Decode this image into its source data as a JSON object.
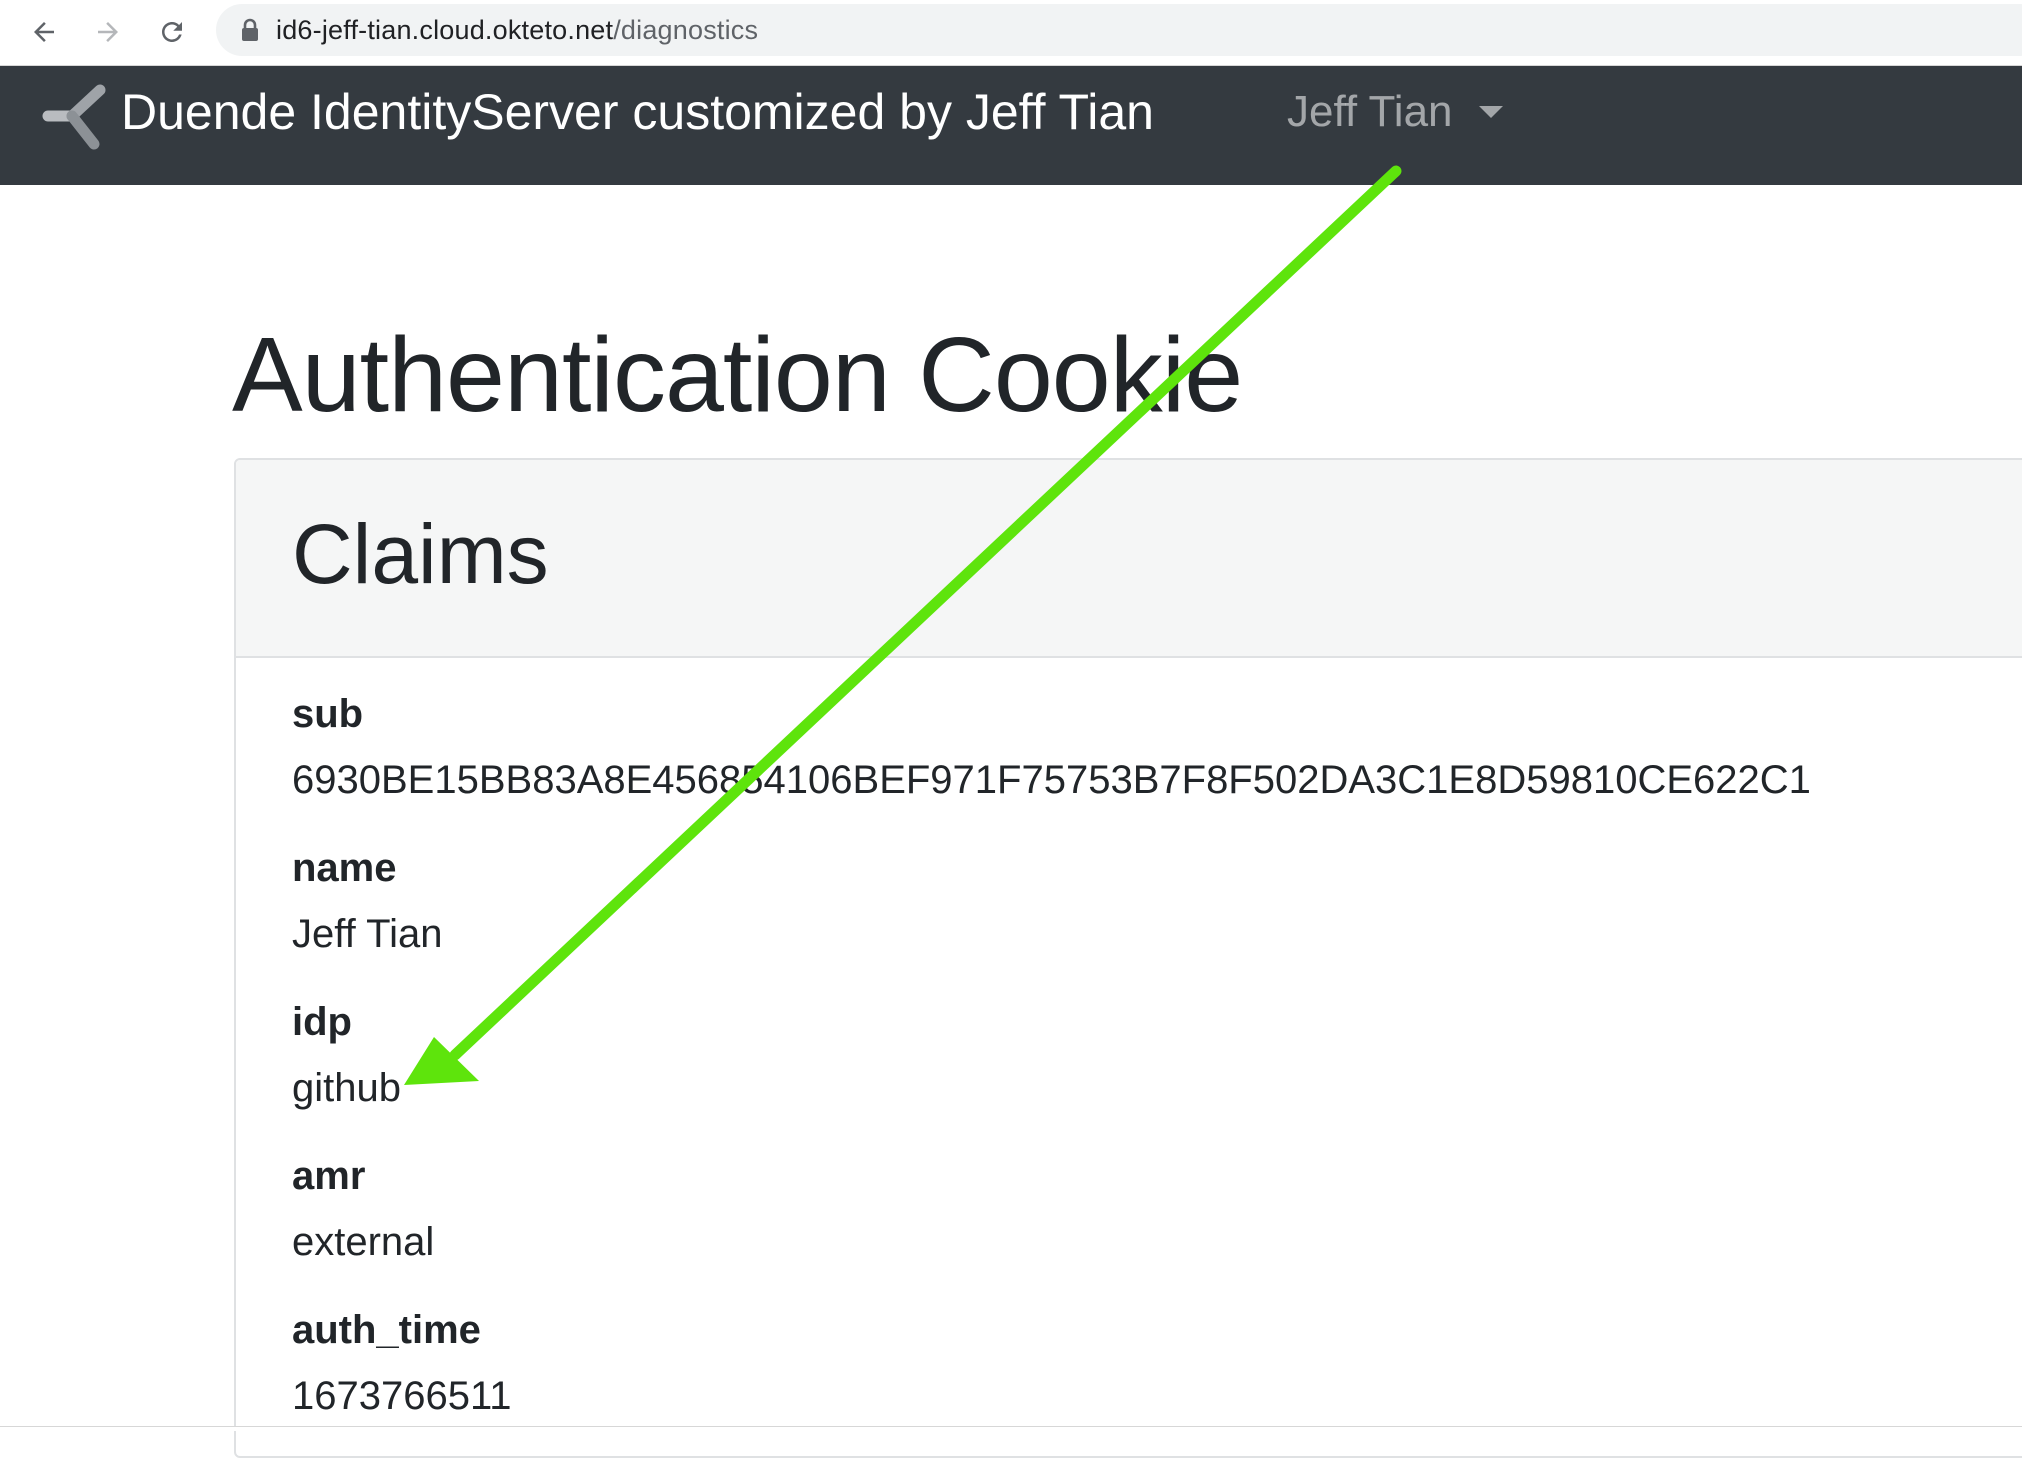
{
  "browser": {
    "url_host": "id6-jeff-tian.cloud.okteto.net",
    "url_path": "/diagnostics",
    "icons": {
      "back": "back-arrow-icon",
      "forward": "forward-arrow-icon",
      "reload": "reload-icon",
      "lock": "lock-icon"
    }
  },
  "navbar": {
    "brand_title": "Duende IdentityServer customized by Jeff Tian",
    "user_menu_label": "Jeff Tian",
    "background_color": "#343a40"
  },
  "page": {
    "title": "Authentication Cookie",
    "claims_card": {
      "heading": "Claims",
      "claims": [
        {
          "term": "sub",
          "value": "6930BE15BB83A8E456854106BEF971F75753B7F8F502DA3C1E8D59810CE622C1"
        },
        {
          "term": "name",
          "value": "Jeff Tian"
        },
        {
          "term": "idp",
          "value": "github"
        },
        {
          "term": "amr",
          "value": "external"
        },
        {
          "term": "auth_time",
          "value": "1673766511"
        }
      ]
    }
  },
  "annotation": {
    "arrow_color": "#5ee40c"
  }
}
